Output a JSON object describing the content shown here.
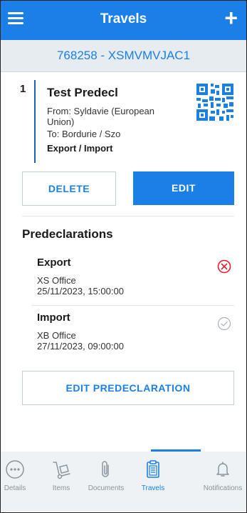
{
  "header": {
    "title": "Travels",
    "menu_icon": "hamburger-menu-icon",
    "add_icon": "plus-icon"
  },
  "travel_code": "768258 - XSMVMVJAC1",
  "travel": {
    "number": "1",
    "name": "Test Predecl",
    "from": "From: Syldavie (European Union)",
    "to": "To: Bordurie / Szo",
    "type": "Export / Import",
    "qr_icon": "qr-code-icon"
  },
  "actions": {
    "delete": "DELETE",
    "edit": "EDIT",
    "edit_predeclaration": "EDIT PREDECLARATION"
  },
  "predeclarations": {
    "title": "Predeclarations",
    "items": [
      {
        "name": "Export",
        "office": "XS Office",
        "datetime": "25/11/2023, 15:00:00",
        "status_icon": "error-circle-icon"
      },
      {
        "name": "Import",
        "office": "XB Office",
        "datetime": "27/11/2023, 09:00:00",
        "status_icon": "check-circle-icon"
      }
    ]
  },
  "colors": {
    "primary": "#1a7fe6",
    "error": "#e0202f",
    "muted": "#8a959c"
  },
  "nav": [
    {
      "label": "Details",
      "icon": "more-dots-icon"
    },
    {
      "label": "Items",
      "icon": "hand-truck-icon"
    },
    {
      "label": "Documents",
      "icon": "paperclip-icon"
    },
    {
      "label": "Travels",
      "icon": "clipboard-icon"
    },
    {
      "label": "Notifications",
      "icon": "bell-icon"
    }
  ]
}
